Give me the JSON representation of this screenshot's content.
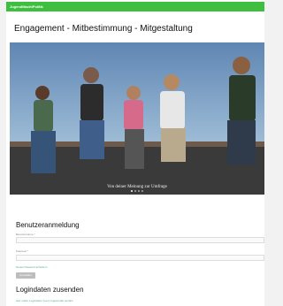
{
  "header": {
    "brand": "JugendMachtPolitik"
  },
  "page": {
    "title": "Engagement - Mitbestimmung - Mitgestaltung"
  },
  "hero": {
    "caption": "Von deiner Meinung zur Umfrage",
    "slide_count": 4,
    "active_slide": 1
  },
  "login": {
    "title": "Benutzeranmeldung",
    "username_label": "Benutzername *",
    "password_label": "Passwort *",
    "remember_label": "Neues Passwort anfordern",
    "submit_label": "Anmelden"
  },
  "send_login": {
    "title": "Logindaten zusenden",
    "link_text": "Hier sollen Logindaten (neu) zugesendet werden"
  },
  "colors": {
    "topbar": "#3fbf3f",
    "link": "#55aa88"
  }
}
